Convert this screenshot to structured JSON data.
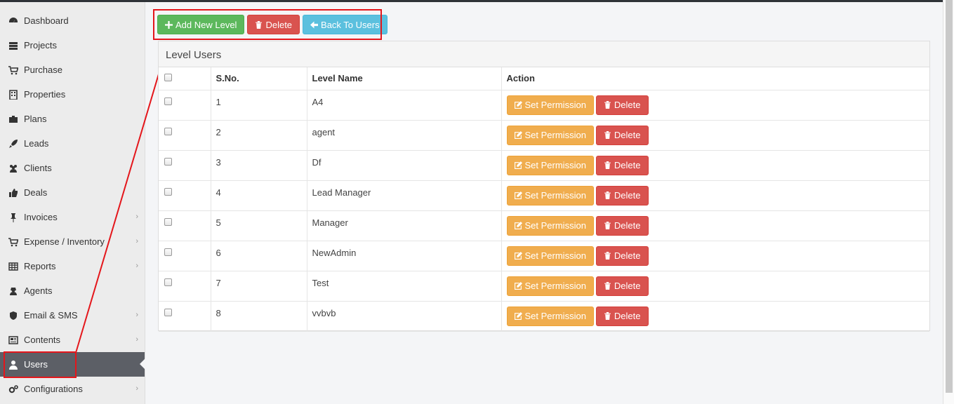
{
  "sidebar": {
    "items": [
      {
        "label": "Dashboard",
        "icon": "dashboard-icon",
        "submenu": false
      },
      {
        "label": "Projects",
        "icon": "server-icon",
        "submenu": false
      },
      {
        "label": "Purchase",
        "icon": "cart-icon",
        "submenu": false
      },
      {
        "label": "Properties",
        "icon": "building-icon",
        "submenu": false
      },
      {
        "label": "Plans",
        "icon": "briefcase-icon",
        "submenu": false
      },
      {
        "label": "Leads",
        "icon": "rocket-icon",
        "submenu": false
      },
      {
        "label": "Clients",
        "icon": "users-icon",
        "submenu": false
      },
      {
        "label": "Deals",
        "icon": "thumbs-up-icon",
        "submenu": false
      },
      {
        "label": "Invoices",
        "icon": "thumbtack-icon",
        "submenu": true
      },
      {
        "label": "Expense / Inventory",
        "icon": "cart-icon",
        "submenu": true
      },
      {
        "label": "Reports",
        "icon": "table-icon",
        "submenu": true
      },
      {
        "label": "Agents",
        "icon": "user-secret-icon",
        "submenu": false
      },
      {
        "label": "Email & SMS",
        "icon": "shield-icon",
        "submenu": true
      },
      {
        "label": "Contents",
        "icon": "newspaper-icon",
        "submenu": true
      },
      {
        "label": "Users",
        "icon": "user-icon",
        "submenu": false,
        "active": true
      },
      {
        "label": "Configurations",
        "icon": "cogs-icon",
        "submenu": true
      }
    ]
  },
  "toolbar": {
    "add_label": "Add New Level",
    "delete_label": "Delete",
    "back_label": "Back To Users"
  },
  "panel": {
    "title": "Level Users",
    "columns": [
      "",
      "S.No.",
      "Level Name",
      "Action"
    ],
    "rows": [
      {
        "sno": "1",
        "name": "A4"
      },
      {
        "sno": "2",
        "name": "agent"
      },
      {
        "sno": "3",
        "name": "Df"
      },
      {
        "sno": "4",
        "name": "Lead Manager"
      },
      {
        "sno": "5",
        "name": "Manager"
      },
      {
        "sno": "6",
        "name": "NewAdmin"
      },
      {
        "sno": "7",
        "name": "Test"
      },
      {
        "sno": "8",
        "name": "vvbvb"
      }
    ],
    "set_permission_label": "Set Permission",
    "row_delete_label": "Delete"
  },
  "colors": {
    "success": "#5cb85c",
    "danger": "#d9534f",
    "info": "#5bc0de",
    "warning": "#f0ad4e",
    "annotation": "#e4161b",
    "sidebar_active": "#5c5f66"
  }
}
